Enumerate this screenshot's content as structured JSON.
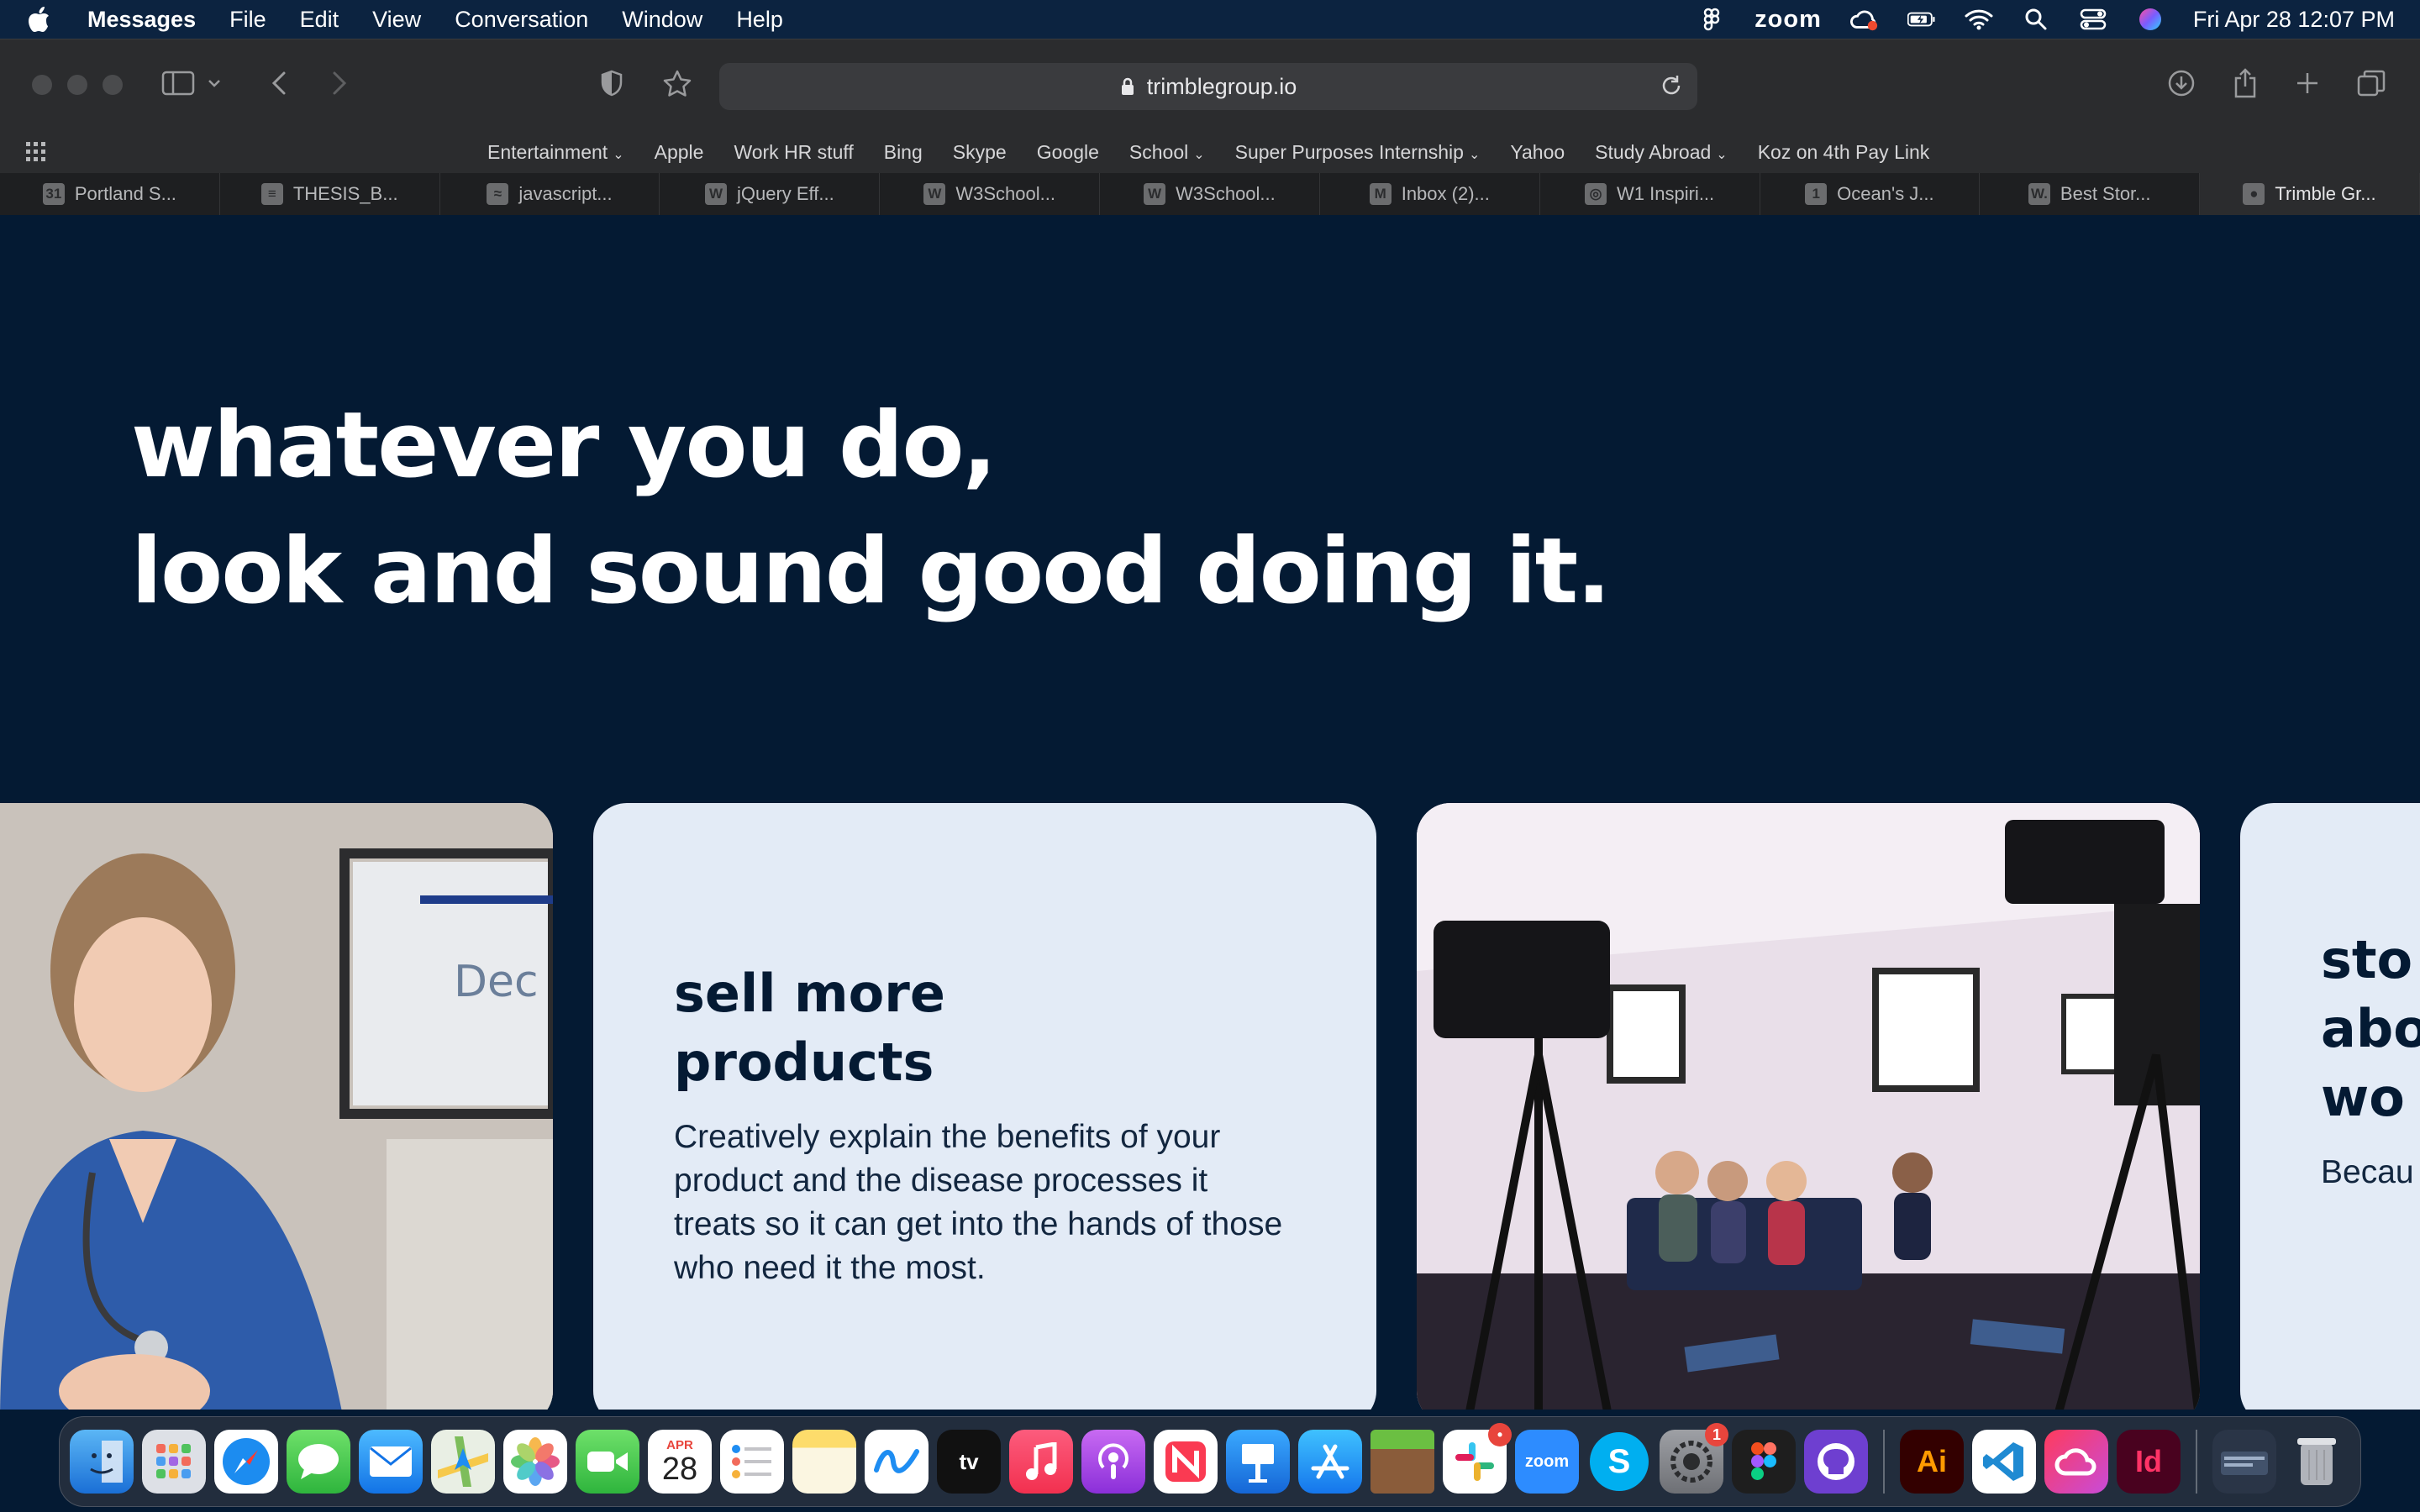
{
  "menubar": {
    "app_name": "Messages",
    "items": [
      "File",
      "Edit",
      "View",
      "Conversation",
      "Window",
      "Help"
    ],
    "zoom_label": "zoom",
    "datetime": "Fri Apr 28  12:07 PM"
  },
  "browser": {
    "url": "trimblegroup.io",
    "favorites": [
      {
        "label": "Entertainment",
        "folder": true
      },
      {
        "label": "Apple",
        "folder": false
      },
      {
        "label": "Work HR stuff",
        "folder": false
      },
      {
        "label": "Bing",
        "folder": false
      },
      {
        "label": "Skype",
        "folder": false
      },
      {
        "label": "Google",
        "folder": false
      },
      {
        "label": "School",
        "folder": true
      },
      {
        "label": "Super Purposes Internship",
        "folder": true
      },
      {
        "label": "Yahoo",
        "folder": false
      },
      {
        "label": "Study Abroad",
        "folder": true
      },
      {
        "label": "Koz on 4th Pay Link",
        "folder": false
      }
    ],
    "tabs": [
      {
        "label": "Portland S...",
        "icon": "31"
      },
      {
        "label": "THESIS_B...",
        "icon": "≡"
      },
      {
        "label": "javascript...",
        "icon": "≈"
      },
      {
        "label": "jQuery Eff...",
        "icon": "W"
      },
      {
        "label": "W3School...",
        "icon": "W"
      },
      {
        "label": "W3School...",
        "icon": "W"
      },
      {
        "label": "Inbox (2)...",
        "icon": "M"
      },
      {
        "label": "W1 Inspiri...",
        "icon": "◎"
      },
      {
        "label": "Ocean's J...",
        "icon": "1"
      },
      {
        "label": "Best Stor...",
        "icon": "W."
      },
      {
        "label": "Trimble Gr...",
        "icon": "●"
      }
    ]
  },
  "page": {
    "hero_line1": "whatever you do,",
    "hero_line2": "look and sound good doing it.",
    "card1": {
      "title_line1": "sell more",
      "title_line2": "products",
      "body": "Creatively explain the benefits of your product and the disease processes it treats so it can get into the hands of those who need it the most."
    },
    "card2": {
      "title_line1": "sto",
      "title_line2": "abo",
      "title_line3": "wo",
      "body": "Becau make a interes clear a"
    },
    "photo1_sign": "Dec"
  },
  "dock": {
    "calendar_month": "APR",
    "calendar_day": "28",
    "appletv_label": "tv",
    "zoom_label": "zoom",
    "slack_badge": "•",
    "settings_badge": "1",
    "ai_label": "Ai",
    "id_label": "Id",
    "skype_label": "S"
  }
}
